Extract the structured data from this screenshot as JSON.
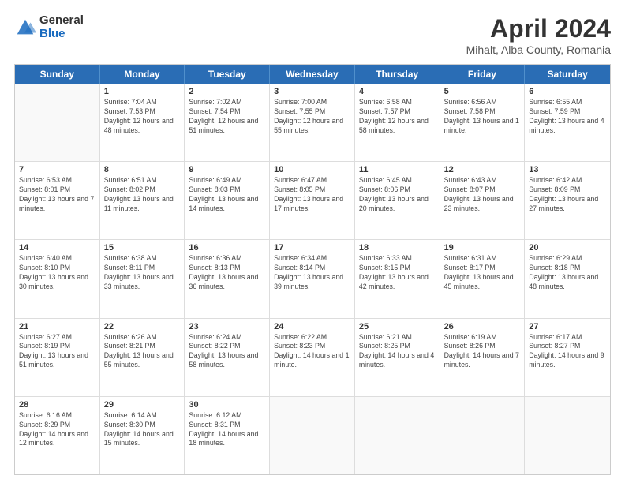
{
  "header": {
    "logo_general": "General",
    "logo_blue": "Blue",
    "title": "April 2024",
    "location": "Mihalt, Alba County, Romania"
  },
  "weekdays": [
    "Sunday",
    "Monday",
    "Tuesday",
    "Wednesday",
    "Thursday",
    "Friday",
    "Saturday"
  ],
  "rows": [
    [
      {
        "day": "",
        "sunrise": "",
        "sunset": "",
        "daylight": ""
      },
      {
        "day": "1",
        "sunrise": "7:04 AM",
        "sunset": "7:53 PM",
        "daylight": "12 hours and 48 minutes."
      },
      {
        "day": "2",
        "sunrise": "7:02 AM",
        "sunset": "7:54 PM",
        "daylight": "12 hours and 51 minutes."
      },
      {
        "day": "3",
        "sunrise": "7:00 AM",
        "sunset": "7:55 PM",
        "daylight": "12 hours and 55 minutes."
      },
      {
        "day": "4",
        "sunrise": "6:58 AM",
        "sunset": "7:57 PM",
        "daylight": "12 hours and 58 minutes."
      },
      {
        "day": "5",
        "sunrise": "6:56 AM",
        "sunset": "7:58 PM",
        "daylight": "13 hours and 1 minute."
      },
      {
        "day": "6",
        "sunrise": "6:55 AM",
        "sunset": "7:59 PM",
        "daylight": "13 hours and 4 minutes."
      }
    ],
    [
      {
        "day": "7",
        "sunrise": "6:53 AM",
        "sunset": "8:01 PM",
        "daylight": "13 hours and 7 minutes."
      },
      {
        "day": "8",
        "sunrise": "6:51 AM",
        "sunset": "8:02 PM",
        "daylight": "13 hours and 11 minutes."
      },
      {
        "day": "9",
        "sunrise": "6:49 AM",
        "sunset": "8:03 PM",
        "daylight": "13 hours and 14 minutes."
      },
      {
        "day": "10",
        "sunrise": "6:47 AM",
        "sunset": "8:05 PM",
        "daylight": "13 hours and 17 minutes."
      },
      {
        "day": "11",
        "sunrise": "6:45 AM",
        "sunset": "8:06 PM",
        "daylight": "13 hours and 20 minutes."
      },
      {
        "day": "12",
        "sunrise": "6:43 AM",
        "sunset": "8:07 PM",
        "daylight": "13 hours and 23 minutes."
      },
      {
        "day": "13",
        "sunrise": "6:42 AM",
        "sunset": "8:09 PM",
        "daylight": "13 hours and 27 minutes."
      }
    ],
    [
      {
        "day": "14",
        "sunrise": "6:40 AM",
        "sunset": "8:10 PM",
        "daylight": "13 hours and 30 minutes."
      },
      {
        "day": "15",
        "sunrise": "6:38 AM",
        "sunset": "8:11 PM",
        "daylight": "13 hours and 33 minutes."
      },
      {
        "day": "16",
        "sunrise": "6:36 AM",
        "sunset": "8:13 PM",
        "daylight": "13 hours and 36 minutes."
      },
      {
        "day": "17",
        "sunrise": "6:34 AM",
        "sunset": "8:14 PM",
        "daylight": "13 hours and 39 minutes."
      },
      {
        "day": "18",
        "sunrise": "6:33 AM",
        "sunset": "8:15 PM",
        "daylight": "13 hours and 42 minutes."
      },
      {
        "day": "19",
        "sunrise": "6:31 AM",
        "sunset": "8:17 PM",
        "daylight": "13 hours and 45 minutes."
      },
      {
        "day": "20",
        "sunrise": "6:29 AM",
        "sunset": "8:18 PM",
        "daylight": "13 hours and 48 minutes."
      }
    ],
    [
      {
        "day": "21",
        "sunrise": "6:27 AM",
        "sunset": "8:19 PM",
        "daylight": "13 hours and 51 minutes."
      },
      {
        "day": "22",
        "sunrise": "6:26 AM",
        "sunset": "8:21 PM",
        "daylight": "13 hours and 55 minutes."
      },
      {
        "day": "23",
        "sunrise": "6:24 AM",
        "sunset": "8:22 PM",
        "daylight": "13 hours and 58 minutes."
      },
      {
        "day": "24",
        "sunrise": "6:22 AM",
        "sunset": "8:23 PM",
        "daylight": "14 hours and 1 minute."
      },
      {
        "day": "25",
        "sunrise": "6:21 AM",
        "sunset": "8:25 PM",
        "daylight": "14 hours and 4 minutes."
      },
      {
        "day": "26",
        "sunrise": "6:19 AM",
        "sunset": "8:26 PM",
        "daylight": "14 hours and 7 minutes."
      },
      {
        "day": "27",
        "sunrise": "6:17 AM",
        "sunset": "8:27 PM",
        "daylight": "14 hours and 9 minutes."
      }
    ],
    [
      {
        "day": "28",
        "sunrise": "6:16 AM",
        "sunset": "8:29 PM",
        "daylight": "14 hours and 12 minutes."
      },
      {
        "day": "29",
        "sunrise": "6:14 AM",
        "sunset": "8:30 PM",
        "daylight": "14 hours and 15 minutes."
      },
      {
        "day": "30",
        "sunrise": "6:12 AM",
        "sunset": "8:31 PM",
        "daylight": "14 hours and 18 minutes."
      },
      {
        "day": "",
        "sunrise": "",
        "sunset": "",
        "daylight": ""
      },
      {
        "day": "",
        "sunrise": "",
        "sunset": "",
        "daylight": ""
      },
      {
        "day": "",
        "sunrise": "",
        "sunset": "",
        "daylight": ""
      },
      {
        "day": "",
        "sunrise": "",
        "sunset": "",
        "daylight": ""
      }
    ]
  ]
}
